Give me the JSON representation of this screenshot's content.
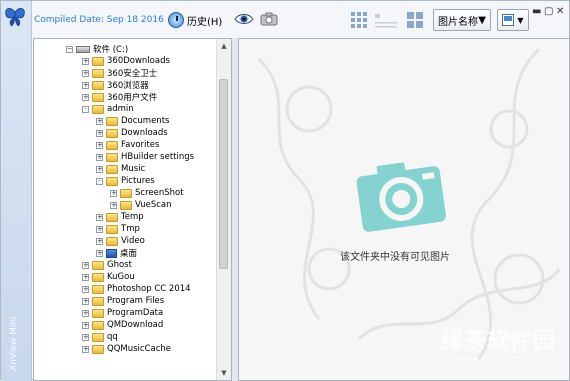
{
  "header": {
    "compiled_date": "Compiled Date: Sep 18 2016",
    "history_label": "历史(H)",
    "sort_label": "图片名称"
  },
  "left_strip": {
    "vertical_text": "XnView Mini"
  },
  "tree": {
    "root": "软件 (C:)",
    "items": [
      {
        "label": "360Downloads",
        "level": 1,
        "expander": "+",
        "icon": "folder"
      },
      {
        "label": "360安全卫士",
        "level": 1,
        "expander": "+",
        "icon": "folder"
      },
      {
        "label": "360浏览器",
        "level": 1,
        "expander": "+",
        "icon": "folder"
      },
      {
        "label": "360用户文件",
        "level": 1,
        "expander": "+",
        "icon": "folder"
      },
      {
        "label": "admin",
        "level": 1,
        "expander": "-",
        "icon": "folder"
      },
      {
        "label": "Documents",
        "level": 2,
        "expander": "+",
        "icon": "folder"
      },
      {
        "label": "Downloads",
        "level": 2,
        "expander": "+",
        "icon": "folder"
      },
      {
        "label": "Favorites",
        "level": 2,
        "expander": "+",
        "icon": "folder"
      },
      {
        "label": "HBuilder settings",
        "level": 2,
        "expander": "+",
        "icon": "folder"
      },
      {
        "label": "Music",
        "level": 2,
        "expander": "+",
        "icon": "folder"
      },
      {
        "label": "Pictures",
        "level": 2,
        "expander": "-",
        "icon": "folder"
      },
      {
        "label": "ScreenShot",
        "level": 3,
        "expander": "+",
        "icon": "folder"
      },
      {
        "label": "VueScan",
        "level": 3,
        "expander": "+",
        "icon": "folder"
      },
      {
        "label": "Temp",
        "level": 2,
        "expander": "+",
        "icon": "folder"
      },
      {
        "label": "Tmp",
        "level": 2,
        "expander": "+",
        "icon": "folder"
      },
      {
        "label": "Video",
        "level": 2,
        "expander": "+",
        "icon": "folder"
      },
      {
        "label": "桌面",
        "level": 2,
        "expander": "+",
        "icon": "desktop"
      },
      {
        "label": "Ghost",
        "level": 1,
        "expander": "+",
        "icon": "folder"
      },
      {
        "label": "KuGou",
        "level": 1,
        "expander": "+",
        "icon": "folder"
      },
      {
        "label": "Photoshop CC 2014",
        "level": 1,
        "expander": "+",
        "icon": "folder"
      },
      {
        "label": "Program Files",
        "level": 1,
        "expander": "+",
        "icon": "folder"
      },
      {
        "label": "ProgramData",
        "level": 1,
        "expander": "+",
        "icon": "folder"
      },
      {
        "label": "QMDownload",
        "level": 1,
        "expander": "+",
        "icon": "folder"
      },
      {
        "label": "qq",
        "level": 1,
        "expander": "+",
        "icon": "folder"
      },
      {
        "label": "QQMusicCache",
        "level": 1,
        "expander": "+",
        "icon": "folder"
      }
    ]
  },
  "preview": {
    "empty_message": "该文件夹中没有可见图片",
    "watermark_text": "绿茶软件园",
    "watermark_url": "www.33LC.com"
  },
  "colors": {
    "accent": "#2a7ecf",
    "camera": "#7fd0cf"
  }
}
